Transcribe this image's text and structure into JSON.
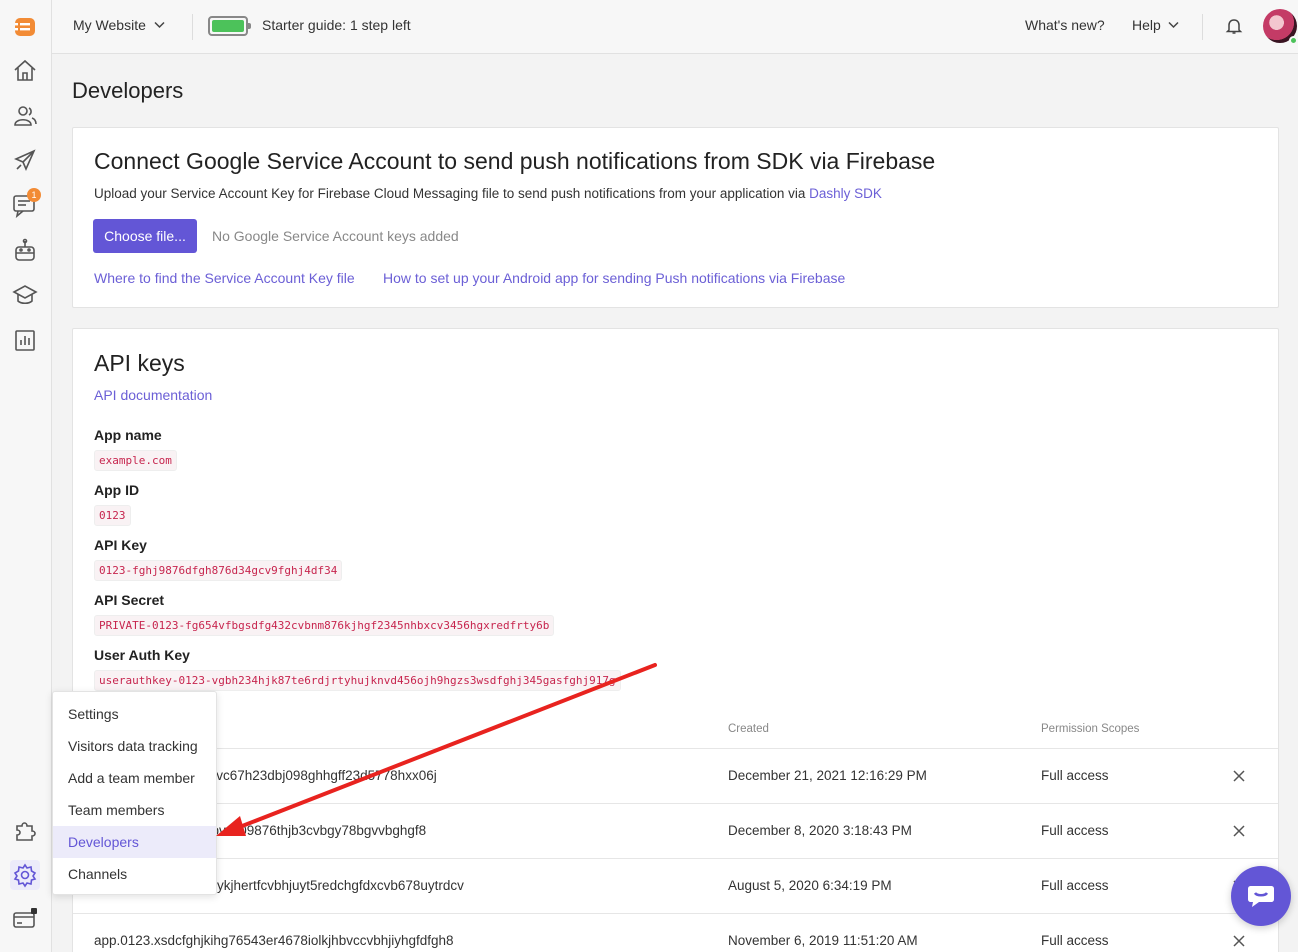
{
  "topbar": {
    "site": "My Website",
    "guide": "Starter guide: 1 step left",
    "whats_new": "What's new?",
    "help": "Help"
  },
  "sidebar": {
    "badge_count": "1",
    "items": [
      "logo-icon",
      "home-icon",
      "users-icon",
      "rocket-icon",
      "chat-icon",
      "bot-icon",
      "academy-icon",
      "reports-icon",
      "puzzle-icon",
      "settings-icon",
      "billing-icon"
    ]
  },
  "page": {
    "title": "Developers"
  },
  "firebase": {
    "title": "Connect Google Service Account to send push notifications from SDK via Firebase",
    "subtitle": "Upload your Service Account Key for Firebase Cloud Messaging file to send push notifications from your application via",
    "subtitle_link": "Dashly SDK",
    "choose_button": "Choose file...",
    "no_keys": "No Google Service Account keys added",
    "link1": "Where to find the Service Account Key file",
    "link2": "How to set up your Android app for sending Push notifications via Firebase"
  },
  "api": {
    "title": "API keys",
    "doc_link": "API documentation",
    "app_name_label": "App name",
    "app_name": "example.com",
    "app_id_label": "App ID",
    "app_id": "0123",
    "api_key_label": "API Key",
    "api_key": "0123-fghj9876dfgh876d34gcv9fghj4df34",
    "api_secret_label": "API Secret",
    "api_secret": "PRIVATE-0123-fg654vfbgsdfg432cvbnm876kjhgf2345nhbxcv3456hgxredfrty6b",
    "user_auth_label": "User Auth Key",
    "user_auth": "userauthkey-0123-vgbh234hjk87te6rdjrtyhujknvd456ojh9hgzs3wsdfghj345gasfghj917g",
    "col_created": "Created",
    "col_perm": "Permission Scopes",
    "rows": [
      {
        "key": "sdvc67h23dbj098ghhgff23d5778hxx06j",
        "created": "December 21, 2021 12:16:29 PM",
        "perm": "Full access"
      },
      {
        "key": "nbvcv09876thjb3cvbgy78bgvvbghgf8",
        "created": "December 8, 2020 3:18:43 PM",
        "perm": "Full access"
      },
      {
        "key": "56ykjhertfcvbhjuyt5redchgfdxcvb678uytrdcv",
        "created": "August 5, 2020 6:34:19 PM",
        "perm": "Full access"
      },
      {
        "key": "app.0123.xsdcfghjkihg76543er4678iolkjhbvccvbhjiyhgfdfgh8",
        "created": "November 6, 2019 11:51:20 AM",
        "perm": "Full access"
      }
    ]
  },
  "menu": {
    "items": [
      "Settings",
      "Visitors data tracking",
      "Add a team member",
      "Team members",
      "Developers",
      "Channels"
    ],
    "active": "Developers"
  },
  "colors": {
    "accent": "#6356d6",
    "arrow": "#e8231f",
    "badge": "#f28b35"
  }
}
